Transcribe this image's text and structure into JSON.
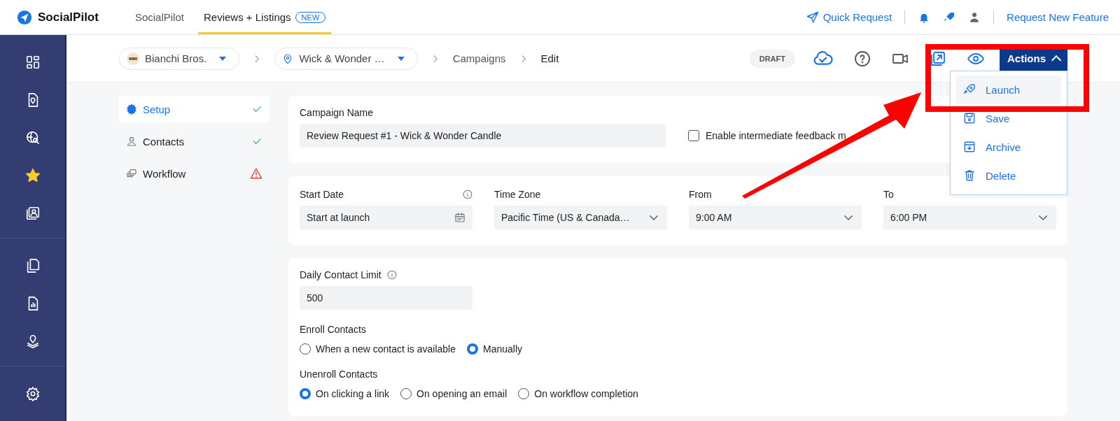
{
  "top_nav": {
    "brand": "SocialPilot",
    "tabs": [
      {
        "label": "SocialPilot",
        "selected": false
      },
      {
        "label": "Reviews + Listings",
        "badge": "NEW",
        "selected": true
      }
    ],
    "quick_request": "Quick Request",
    "request_feature": "Request New Feature"
  },
  "sidebar": {
    "groups": [
      [
        {
          "selected": false
        },
        {
          "selected": false
        },
        {
          "selected": false
        },
        {
          "selected": true
        },
        {
          "selected": false
        }
      ],
      [
        {
          "selected": false
        },
        {
          "selected": false
        },
        {
          "selected": false
        }
      ],
      [
        {
          "selected": false
        }
      ]
    ]
  },
  "breadcrumb": [
    {
      "label": "Bianchi Bros.",
      "kind": "business"
    },
    {
      "label": "Wick & Wonder …",
      "kind": "location"
    },
    {
      "label": "Campaigns",
      "kind": "link"
    },
    {
      "label": "Edit",
      "kind": "current"
    }
  ],
  "status_badge": "DRAFT",
  "actions_button": {
    "label": "Actions",
    "expanded": true
  },
  "actions_menu": [
    {
      "label": "Launch",
      "selected": true
    },
    {
      "label": "Save",
      "selected": false
    },
    {
      "label": "Archive",
      "selected": false
    },
    {
      "label": "Delete",
      "selected": false
    }
  ],
  "steps": [
    {
      "label": "Setup",
      "selected": true,
      "complete": true
    },
    {
      "label": "Contacts",
      "selected": false,
      "complete": true
    },
    {
      "label": "Workflow",
      "selected": false,
      "complete": false
    }
  ],
  "campaign_name": {
    "label": "Campaign Name",
    "value": "Review Request #1 - Wick & Wonder Candle"
  },
  "feedback_checkbox": {
    "label": "Enable intermediate feedback m",
    "checked": false
  },
  "schedule": [
    {
      "label": "Start Date",
      "value": "Start at launch",
      "kind": "date"
    },
    {
      "label": "Time Zone",
      "value": "Pacific Time (US & Canada…",
      "kind": "select"
    },
    {
      "label": "From",
      "value": "9:00 AM",
      "kind": "select"
    },
    {
      "label": "To",
      "value": "6:00 PM",
      "kind": "select"
    }
  ],
  "daily_limit": {
    "label": "Daily Contact Limit",
    "value": "500"
  },
  "radio_groups": [
    {
      "label": "Enroll Contacts",
      "options": [
        {
          "label": "When a new contact is available",
          "selected": false
        },
        {
          "label": "Manually",
          "selected": true
        }
      ]
    },
    {
      "label": "Unenroll Contacts",
      "options": [
        {
          "label": "On clicking a link",
          "selected": true
        },
        {
          "label": "On opening an email",
          "selected": false
        },
        {
          "label": "On workflow completion",
          "selected": false
        }
      ]
    }
  ]
}
